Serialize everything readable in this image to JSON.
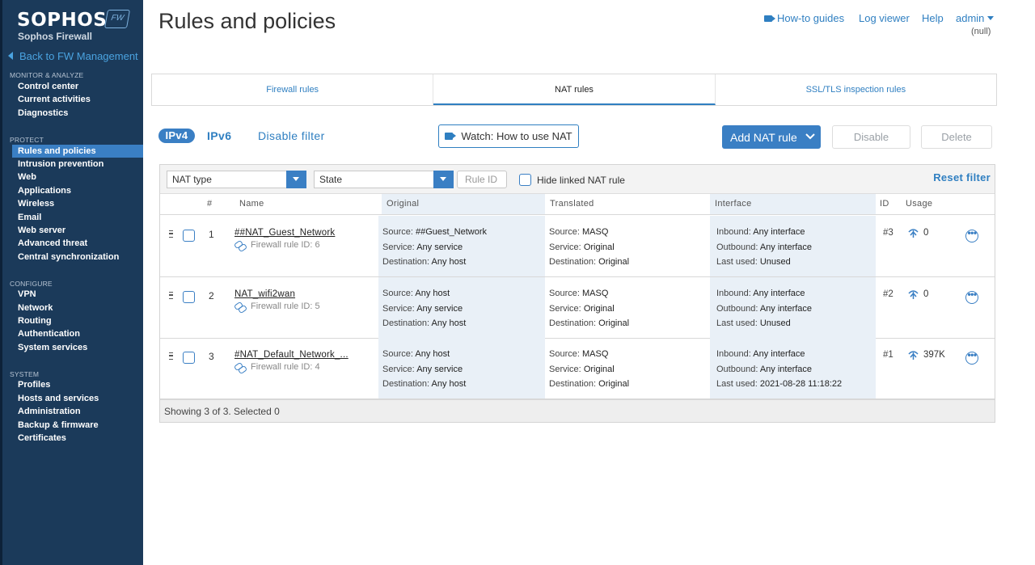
{
  "sidebar": {
    "brand": "SOPHOS",
    "badge": "FW",
    "product": "Sophos Firewall",
    "back_link": "Back to FW Management",
    "sections": [
      {
        "title": "MONITOR & ANALYZE",
        "items": [
          "Control center",
          "Current activities",
          "Diagnostics"
        ]
      },
      {
        "title": "PROTECT",
        "items": [
          "Rules and policies",
          "Intrusion prevention",
          "Web",
          "Applications",
          "Wireless",
          "Email",
          "Web server",
          "Advanced threat",
          "Central synchronization"
        ]
      },
      {
        "title": "CONFIGURE",
        "items": [
          "VPN",
          "Network",
          "Routing",
          "Authentication",
          "System services"
        ]
      },
      {
        "title": "SYSTEM",
        "items": [
          "Profiles",
          "Hosts and services",
          "Administration",
          "Backup & firmware",
          "Certificates"
        ]
      }
    ],
    "active_item": "Rules and policies"
  },
  "header": {
    "title": "Rules and policies",
    "how_to": "How-to guides",
    "log_viewer": "Log viewer",
    "help": "Help",
    "admin": "admin",
    "null_text": "(null)"
  },
  "tabs": [
    {
      "label": "Firewall rules",
      "active": false
    },
    {
      "label": "NAT rules",
      "active": true
    },
    {
      "label": "SSL/TLS inspection rules",
      "active": false
    }
  ],
  "toolbar": {
    "ipv4": "IPv4",
    "ipv6": "IPv6",
    "disable_filter": "Disable filter",
    "watch": "Watch: How to use NAT",
    "add": "Add NAT rule",
    "disable": "Disable",
    "delete": "Delete"
  },
  "filters": {
    "nat_type": "NAT type",
    "state": "State",
    "rule_id_placeholder": "Rule ID",
    "hide_linked": "Hide linked NAT rule",
    "reset": "Reset filter"
  },
  "columns": {
    "num": "#",
    "name": "Name",
    "original": "Original",
    "translated": "Translated",
    "interface": "Interface",
    "id": "ID",
    "usage": "Usage"
  },
  "labels": {
    "source": "Source:",
    "service": "Service:",
    "destination": "Destination:",
    "inbound": "Inbound:",
    "outbound": "Outbound:",
    "last_used": "Last used:"
  },
  "rows": [
    {
      "num": "1",
      "name": "##NAT_Guest_Network",
      "fw_rule": "Firewall rule ID: 6",
      "orig_source": "##Guest_Network",
      "orig_service": "Any service",
      "orig_destination": "Any host",
      "trans_source": "MASQ",
      "trans_service": "Original",
      "trans_destination": "Original",
      "inbound": "Any interface",
      "outbound": "Any interface",
      "last_used": "Unused",
      "id": "#3",
      "usage": "0"
    },
    {
      "num": "2",
      "name": "NAT_wifi2wan",
      "fw_rule": "Firewall rule ID: 5",
      "orig_source": "Any host",
      "orig_service": "Any service",
      "orig_destination": "Any host",
      "trans_source": "MASQ",
      "trans_service": "Original",
      "trans_destination": "Original",
      "inbound": "Any interface",
      "outbound": "Any interface",
      "last_used": "Unused",
      "id": "#2",
      "usage": "0"
    },
    {
      "num": "3",
      "name": "#NAT_Default_Network_...",
      "fw_rule": "Firewall rule ID: 4",
      "orig_source": "Any host",
      "orig_service": "Any service",
      "orig_destination": "Any host",
      "trans_source": "MASQ",
      "trans_service": "Original",
      "trans_destination": "Original",
      "inbound": "Any interface",
      "outbound": "Any interface",
      "last_used": "2021-08-28 11:18:22",
      "id": "#1",
      "usage": "397K"
    }
  ],
  "footer": "Showing 3 of 3. Selected 0",
  "colors": {
    "sidebar_bg": "#1b3a5a",
    "accent": "#3a7fc4",
    "link": "#2f7fc1",
    "column_shade": "#e9f0f7"
  }
}
